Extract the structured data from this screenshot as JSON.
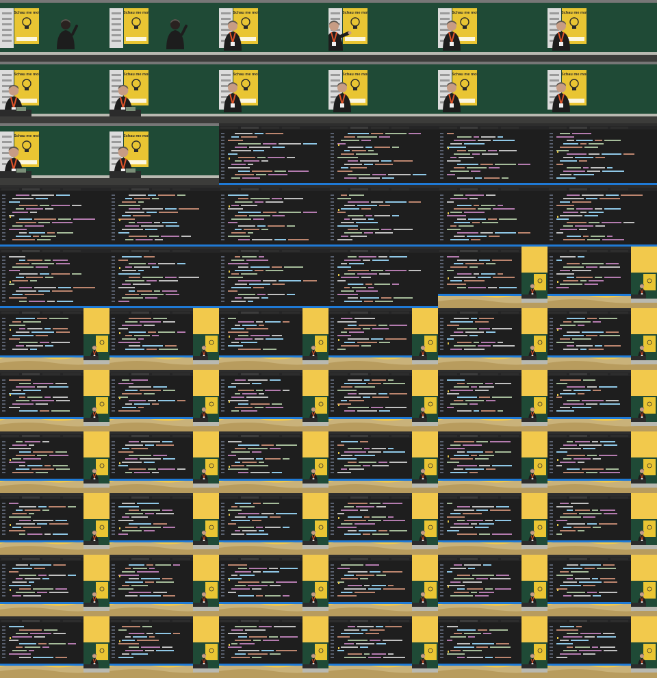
{
  "sheet": {
    "columns": 6,
    "rows": 11,
    "poster_text": "Schau me mol",
    "frames": [
      {
        "scene": "stage",
        "pose": "back"
      },
      {
        "scene": "stage",
        "pose": "back"
      },
      {
        "scene": "stage",
        "pose": "front"
      },
      {
        "scene": "stage",
        "pose": "side"
      },
      {
        "scene": "stage",
        "pose": "front"
      },
      {
        "scene": "stage",
        "pose": "front"
      },
      {
        "scene": "stage",
        "pose": "desk"
      },
      {
        "scene": "stage",
        "pose": "desk"
      },
      {
        "scene": "stage",
        "pose": "front"
      },
      {
        "scene": "stage",
        "pose": "front"
      },
      {
        "scene": "stage",
        "pose": "front"
      },
      {
        "scene": "stage",
        "pose": "front"
      },
      {
        "scene": "stage",
        "pose": "desk"
      },
      {
        "scene": "stage",
        "pose": "desk"
      },
      {
        "scene": "code"
      },
      {
        "scene": "code"
      },
      {
        "scene": "code"
      },
      {
        "scene": "code"
      },
      {
        "scene": "code"
      },
      {
        "scene": "code"
      },
      {
        "scene": "code"
      },
      {
        "scene": "code"
      },
      {
        "scene": "code"
      },
      {
        "scene": "code"
      },
      {
        "scene": "code"
      },
      {
        "scene": "code"
      },
      {
        "scene": "code"
      },
      {
        "scene": "code"
      },
      {
        "scene": "pip"
      },
      {
        "scene": "pip"
      },
      {
        "scene": "pip"
      },
      {
        "scene": "pip"
      },
      {
        "scene": "pip"
      },
      {
        "scene": "pip"
      },
      {
        "scene": "pip"
      },
      {
        "scene": "pip"
      },
      {
        "scene": "pip"
      },
      {
        "scene": "pip"
      },
      {
        "scene": "pip"
      },
      {
        "scene": "pip"
      },
      {
        "scene": "pip"
      },
      {
        "scene": "pip"
      },
      {
        "scene": "pip"
      },
      {
        "scene": "pip"
      },
      {
        "scene": "pip"
      },
      {
        "scene": "pip"
      },
      {
        "scene": "pip"
      },
      {
        "scene": "pip"
      },
      {
        "scene": "pip"
      },
      {
        "scene": "pip"
      },
      {
        "scene": "pip"
      },
      {
        "scene": "pip"
      },
      {
        "scene": "pip"
      },
      {
        "scene": "pip"
      },
      {
        "scene": "pip"
      },
      {
        "scene": "pip"
      },
      {
        "scene": "pip"
      },
      {
        "scene": "pip"
      },
      {
        "scene": "pip"
      },
      {
        "scene": "pip"
      },
      {
        "scene": "pip"
      },
      {
        "scene": "pip"
      },
      {
        "scene": "pip"
      },
      {
        "scene": "pip"
      },
      {
        "scene": "pip"
      },
      {
        "scene": "pip"
      }
    ]
  },
  "colors": {
    "board": "#1f4a36",
    "wall": "#8a8a84",
    "floor": "#3c3c3a",
    "poster": "#e9c533",
    "banner": "#dcdcdc",
    "lanyard": "#e0542a",
    "shirt": "#1d1d1d",
    "editor": "#1e1e1e",
    "editor_line": "#3a3f4a",
    "keyword": "#c586c0",
    "string": "#ce9178",
    "number": "#b5cea8",
    "ident": "#9cdcfe",
    "statusbar": "#1f7ad6",
    "yellow_bg": "#f2c94c",
    "slide_sand": "#c9b27a"
  }
}
